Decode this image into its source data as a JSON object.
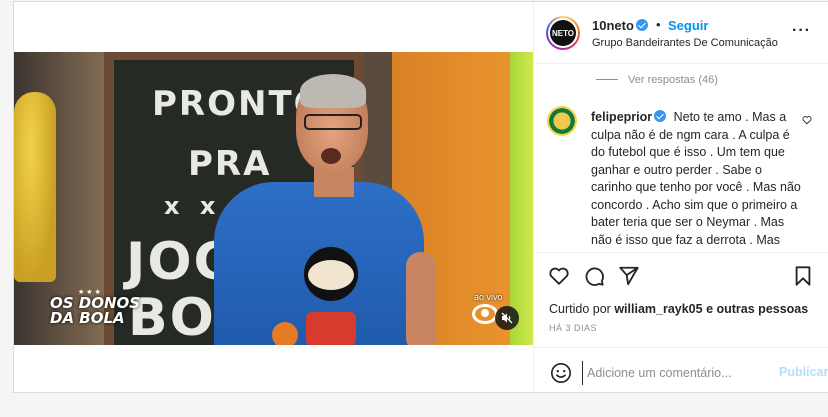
{
  "post": {
    "video": {
      "chalkboard_lines": [
        "PRONTO",
        "PRA",
        "x x x x",
        "JOG",
        "BO"
      ],
      "show_logo": "OS DONOS\nDA BOLA",
      "live_label": "ao vivo",
      "mute_icon": "speaker-muted-icon"
    },
    "header": {
      "username": "10neto",
      "separator": "•",
      "follow_label": "Seguir",
      "subtitle": "Grupo Bandeirantes De Comunicação",
      "more_icon": "ellipsis-icon",
      "avatar_text": "NETO"
    },
    "comments": {
      "view_replies": "Ver respostas (46)",
      "items": [
        {
          "username": "felipeprior",
          "text": "Neto te amo . Mas a culpa não é de ngm cara . A culpa é do futebol que é isso . Um tem que ganhar e outro perder . Sabe o carinho que tenho por você . Mas não concordo . Acho sim que o primeiro a bater teria que ser o Neymar . Mas não é isso que faz a derrota . Mas acho que agora é a"
        }
      ]
    },
    "actions": {
      "liked_prefix": "Curtido por",
      "liked_user": "william_rayk05",
      "liked_suffix": "e outras pessoas",
      "date": "HÁ 3 DIAS"
    },
    "comment_box": {
      "placeholder": "Adicione um comentário...",
      "publish_label": "Publicar"
    }
  },
  "colors": {
    "accent_blue": "#0095f6",
    "publish_disabled": "#b2dffc",
    "muted_text": "#8e8e8e"
  }
}
